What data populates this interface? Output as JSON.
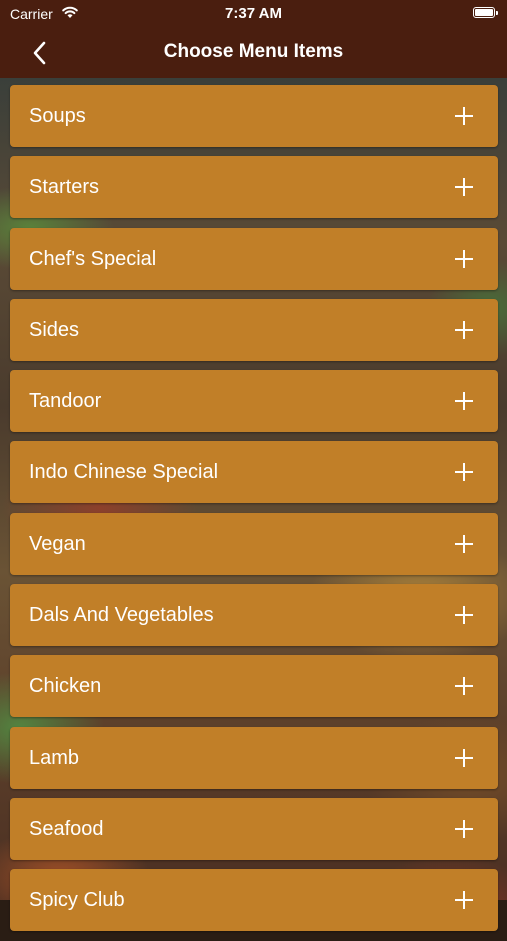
{
  "status_bar": {
    "carrier": "Carrier",
    "time": "7:37 AM",
    "wifi_icon": "wifi-icon",
    "battery_icon": "battery-icon"
  },
  "nav": {
    "title": "Choose Menu Items",
    "back_icon": "chevron-left-icon"
  },
  "colors": {
    "header_bg": "#4a1e0f",
    "row_bg": "#c17f28",
    "text": "#ffffff"
  },
  "menu": {
    "items": [
      {
        "label": "Soups",
        "icon": "plus-icon"
      },
      {
        "label": "Starters",
        "icon": "plus-icon"
      },
      {
        "label": "Chef's Special",
        "icon": "plus-icon"
      },
      {
        "label": "Sides",
        "icon": "plus-icon"
      },
      {
        "label": "Tandoor",
        "icon": "plus-icon"
      },
      {
        "label": "Indo Chinese Special",
        "icon": "plus-icon"
      },
      {
        "label": "Vegan",
        "icon": "plus-icon"
      },
      {
        "label": "Dals And Vegetables",
        "icon": "plus-icon"
      },
      {
        "label": "Chicken",
        "icon": "plus-icon"
      },
      {
        "label": "Lamb",
        "icon": "plus-icon"
      },
      {
        "label": "Seafood",
        "icon": "plus-icon"
      },
      {
        "label": "Spicy Club",
        "icon": "plus-icon"
      }
    ]
  }
}
